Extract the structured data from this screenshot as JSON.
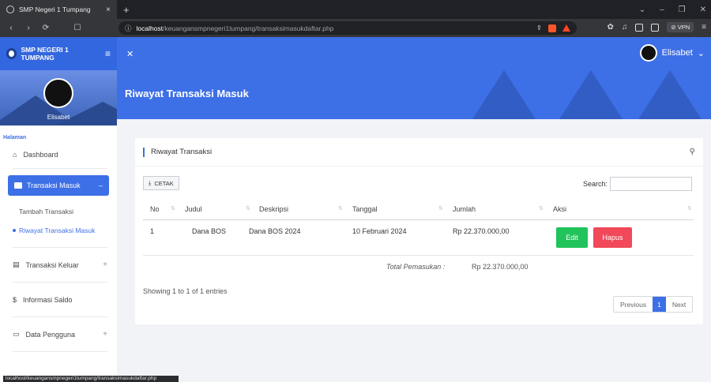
{
  "browser": {
    "tab_title": "SMP Negeri 1 Tumpang",
    "url_host": "localhost",
    "url_path": "/keuangansmpnegeri1tumpang/transaksimasukdaftar.php",
    "vpn_label": "VPN",
    "status_url": "localhost/keuangansmpnegeri1tumpang/transaksimasukdaftar.php"
  },
  "header": {
    "brand": "SMP NEGERI 1 TUMPANG",
    "user_name": "Elisabet"
  },
  "sidebar": {
    "user_name": "Elisabet",
    "section_label": "Halaman",
    "dashboard": "Dashboard",
    "active_group": "Transaksi Masuk",
    "sub_items": [
      "Tambah Transaksi",
      "Riwayat Transaksi Masuk"
    ],
    "transaksi_keluar": "Transaksi Keluar",
    "informasi_saldo": "Informasi Saldo",
    "data_pengguna": "Data Pengguna"
  },
  "page": {
    "title": "Riwayat Transaksi Masuk"
  },
  "card": {
    "title": "Riwayat Transaksi",
    "cetak_label": "CETAK",
    "search_label": "Search:",
    "search_value": "",
    "columns": [
      "No",
      "Judul",
      "Deskripsi",
      "Tanggal",
      "Jumlah",
      "Aksi"
    ],
    "rows": [
      {
        "no": "1",
        "judul": "Dana BOS",
        "deskripsi": "Dana BOS 2024",
        "tanggal": "10 Februari 2024",
        "jumlah": "Rp 22.370.000,00"
      }
    ],
    "edit_label": "Edit",
    "hapus_label": "Hapus",
    "total_label": "Total Pemasukan :",
    "total_value": "Rp 22.370.000,00",
    "showing": "Showing 1 to 1 of 1 entries",
    "pager": {
      "previous": "Previous",
      "page": "1",
      "next": "Next"
    }
  },
  "colors": {
    "primary": "#3d6fe6",
    "edit": "#21c35b",
    "hapus": "#f1495a"
  }
}
